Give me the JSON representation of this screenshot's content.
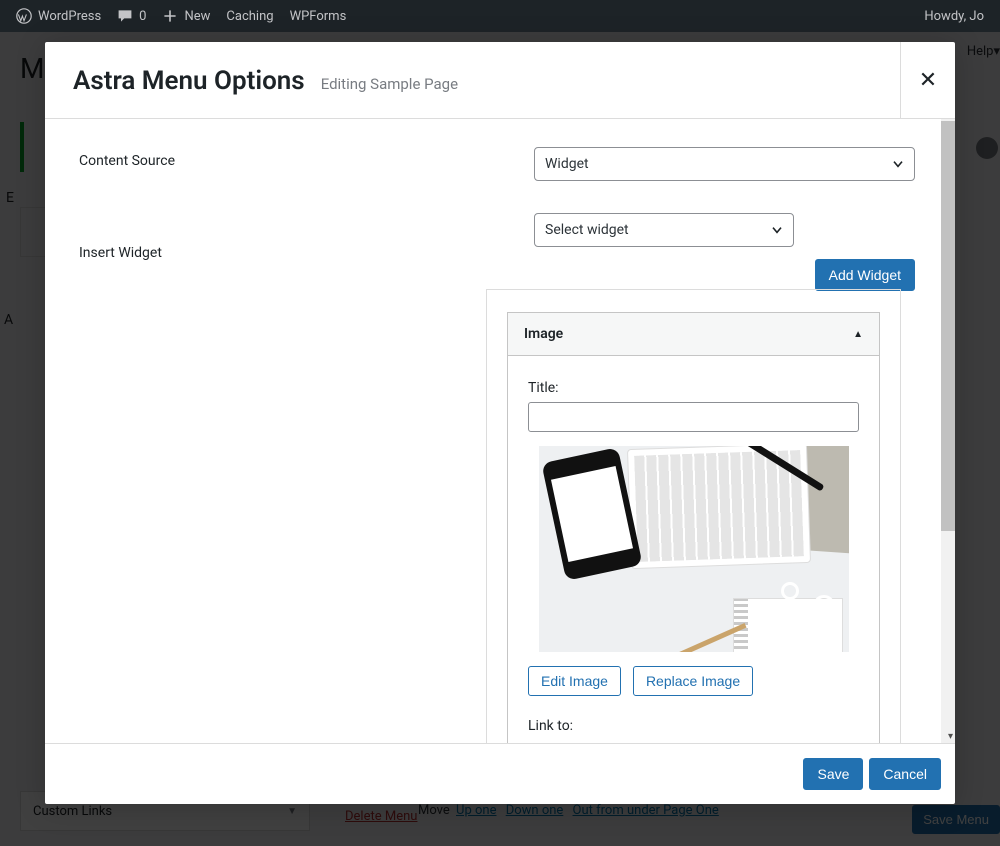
{
  "adminBar": {
    "site": "WordPress",
    "comments": "0",
    "new": "New",
    "caching": "Caching",
    "wpforms": "WPForms",
    "howdy": "Howdy, Jo",
    "help": "Help"
  },
  "background": {
    "mLetter": "M",
    "aLetter": "A",
    "eLetter": "E",
    "customLinks": "Custom Links",
    "deleteMenu": "Delete Menu",
    "move": "Move",
    "upOne": "Up one",
    "downOne": "Down one",
    "outFrom": "Out from under Page One",
    "saveMenu": "Save Menu"
  },
  "modal": {
    "title": "Astra Menu Options",
    "subtitle": "Editing Sample Page",
    "contentSourceLabel": "Content Source",
    "contentSourceValue": "Widget",
    "insertWidgetLabel": "Insert Widget",
    "selectWidgetValue": "Select widget",
    "addWidget": "Add Widget",
    "widgetHeader": "Image",
    "titleLabel": "Title:",
    "editImage": "Edit Image",
    "replaceImage": "Replace Image",
    "linkTo": "Link to:",
    "save": "Save",
    "cancel": "Cancel"
  }
}
